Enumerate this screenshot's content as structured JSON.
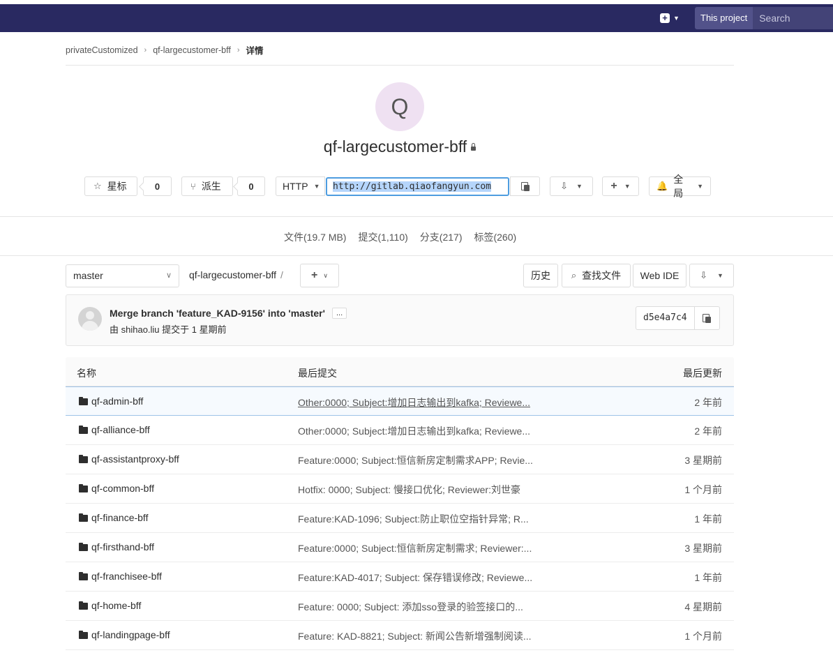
{
  "navbar": {
    "search_scope": "This project",
    "search_placeholder": "Search"
  },
  "breadcrumb": {
    "items": [
      "privateCustomized",
      "qf-largecustomer-bff",
      "详情"
    ]
  },
  "project": {
    "avatar_letter": "Q",
    "name": "qf-largecustomer-bff",
    "star_label": "星标",
    "star_count": "0",
    "fork_label": "派生",
    "fork_count": "0",
    "clone_protocol": "HTTP",
    "clone_url": "http://gitlab.qiaofangyun.com",
    "notification_label": "全局"
  },
  "stats": {
    "files": "文件(19.7 MB)",
    "commits": "提交(1,110)",
    "branches": "分支(217)",
    "tags": "标签(260)"
  },
  "tree": {
    "branch": "master",
    "path": "qf-largecustomer-bff",
    "path_sep": "/",
    "history_label": "历史",
    "find_file_label": "查找文件",
    "web_ide_label": "Web IDE"
  },
  "last_commit": {
    "title": "Merge branch 'feature_KAD-9156' into 'master'",
    "ellipsis": "...",
    "meta": "由 shihao.liu 提交于 1 星期前",
    "sha": "d5e4a7c4"
  },
  "table": {
    "headers": {
      "name": "名称",
      "last_commit": "最后提交",
      "last_update": "最后更新"
    },
    "rows": [
      {
        "name": "qf-admin-bff",
        "commit": "Other:0000; Subject:增加日志输出到kafka; Reviewe...",
        "date": "2 年前"
      },
      {
        "name": "qf-alliance-bff",
        "commit": "Other:0000; Subject:增加日志输出到kafka; Reviewe...",
        "date": "2 年前"
      },
      {
        "name": "qf-assistantproxy-bff",
        "commit": "Feature:0000; Subject:恒信新房定制需求APP; Revie...",
        "date": "3 星期前"
      },
      {
        "name": "qf-common-bff",
        "commit": "Hotfix: 0000; Subject: 慢接口优化; Reviewer:刘世豪",
        "date": "1 个月前"
      },
      {
        "name": "qf-finance-bff",
        "commit": "Feature:KAD-1096; Subject:防止职位空指针异常; R...",
        "date": "1 年前"
      },
      {
        "name": "qf-firsthand-bff",
        "commit": "Feature:0000; Subject:恒信新房定制需求; Reviewer:...",
        "date": "3 星期前"
      },
      {
        "name": "qf-franchisee-bff",
        "commit": "Feature:KAD-4017; Subject: 保存错误修改; Reviewe...",
        "date": "1 年前"
      },
      {
        "name": "qf-home-bff",
        "commit": "Feature: 0000; Subject: 添加sso登录的验签接口的...",
        "date": "4 星期前"
      },
      {
        "name": "qf-landingpage-bff",
        "commit": "Feature: KAD-8821; Subject: 新闻公告新增强制阅读...",
        "date": "1 个月前"
      }
    ]
  }
}
